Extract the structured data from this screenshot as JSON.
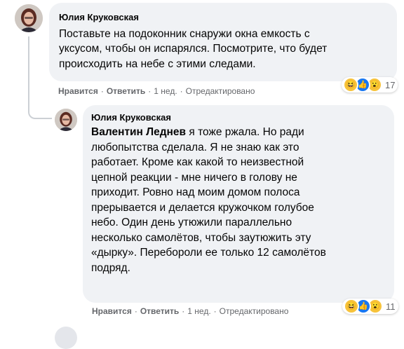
{
  "comments": [
    {
      "author": "Юлия Круковская",
      "lines": [
        "Поставьте на подоконник снаружи окна емкость с",
        "уксусом, чтобы он испарялся. Посмотрите, что будет",
        "происходить на небе с этими следами."
      ],
      "actions": {
        "like": "Нравится",
        "reply": "Ответить",
        "time": "1 нед.",
        "edited": "Отредактировано"
      },
      "reactions": {
        "count": "17",
        "icons": [
          "haha-icon",
          "like-icon",
          "wow-icon"
        ]
      }
    },
    {
      "author": "Юлия Круковская",
      "mention": "Валентин Леднев",
      "first_line_rest": " я тоже ржала. Но ради",
      "lines": [
        "любопытства сделала. Я не знаю как это",
        "работает. Кроме как какой то неизвестной",
        "цепной реакции - мне ничего в голову не",
        "приходит. Ровно над моим домом полоса",
        "прерывается и делается кружочком голубое",
        "небо. Один день утюжили параллельно",
        "несколько самолётов, чтобы заутюжить эту",
        "«дырку». Перебороли ее только 12 самолётов",
        "подряд."
      ],
      "actions": {
        "like": "Нравится",
        "reply": "Ответить",
        "time": "1 нед.",
        "edited": "Отредактировано"
      },
      "reactions": {
        "count": "11",
        "icons": [
          "haha-icon",
          "like-icon",
          "wow-icon"
        ]
      }
    }
  ]
}
